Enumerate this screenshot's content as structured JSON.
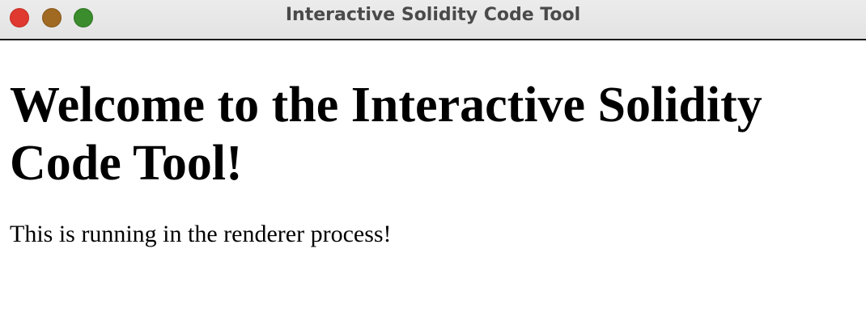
{
  "window": {
    "title": "Interactive Solidity Code Tool",
    "controls": {
      "close_color": "#e0392f",
      "minimize_color": "#a06a22",
      "zoom_color": "#3a8c2c"
    }
  },
  "main": {
    "heading": "Welcome to the Interactive Solidity Code Tool!",
    "message": "This is running in the renderer process!"
  }
}
